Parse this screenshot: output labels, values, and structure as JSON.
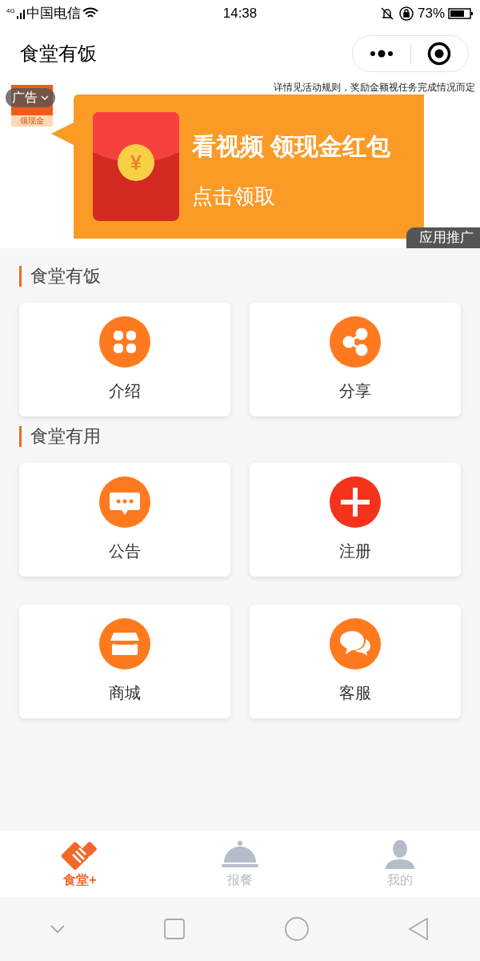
{
  "status_bar": {
    "network": "4G",
    "carrier": "中国电信",
    "time": "14:38",
    "battery": "73%"
  },
  "header": {
    "title": "食堂有饭"
  },
  "ad": {
    "badge": "广告",
    "app_label": "领现金",
    "disclaimer": "详情见活动规则，奖励金额视任务完成情况而定",
    "coin": "¥",
    "headline": "看视频 领现金红包",
    "cta": "点击领取",
    "tag": "应用推广"
  },
  "sections": [
    {
      "title": "食堂有饭",
      "items": [
        {
          "label": "介绍",
          "kind": "clover",
          "color": "#ff7a1f"
        },
        {
          "label": "分享",
          "kind": "share",
          "color": "#ff7a1f"
        }
      ]
    },
    {
      "title": "食堂有用",
      "items": [
        {
          "label": "公告",
          "kind": "chat",
          "color": "#ff7a1f"
        },
        {
          "label": "注册",
          "kind": "plus",
          "color": "#f5331c"
        },
        {
          "label": "商城",
          "kind": "shop",
          "color": "#ff7a1f"
        },
        {
          "label": "客服",
          "kind": "bubbles",
          "color": "#ff7a1f"
        }
      ]
    }
  ],
  "tab_bar": [
    {
      "label": "食堂+",
      "kind": "hands",
      "selected": true
    },
    {
      "label": "报餐",
      "kind": "cloche",
      "selected": false
    },
    {
      "label": "我的",
      "kind": "person",
      "selected": false
    }
  ]
}
